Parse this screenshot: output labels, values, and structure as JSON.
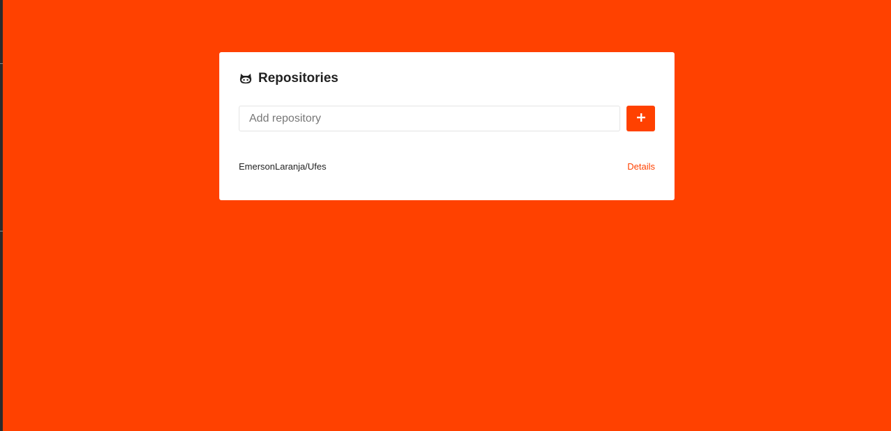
{
  "page": {
    "background_color": "#ff4100",
    "accent_color": "#ff4100"
  },
  "header": {
    "icon": "github-icon",
    "title": "Repositories"
  },
  "form": {
    "input_placeholder": "Add repository",
    "input_value": "",
    "add_button_icon": "plus-icon"
  },
  "repositories": [
    {
      "name": "EmersonLaranja/Ufes",
      "link_label": "Details"
    }
  ]
}
